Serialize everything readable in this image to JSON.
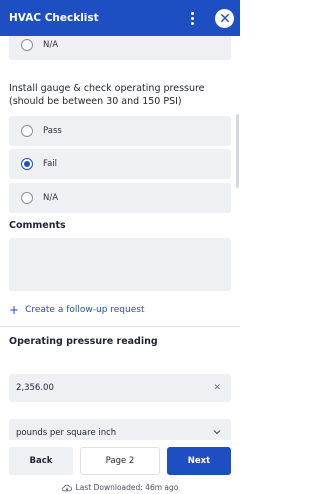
{
  "header": {
    "title": "HVAC Checklist"
  },
  "previous_question": {
    "options": [
      "N/A"
    ]
  },
  "question": {
    "text": "Install gauge & check operating pressure (should be between 30 and 150 PSI)",
    "options": [
      {
        "label": "Pass",
        "selected": false
      },
      {
        "label": "Fail",
        "selected": true
      },
      {
        "label": "N/A",
        "selected": false
      }
    ]
  },
  "comments": {
    "label": "Comments",
    "value": ""
  },
  "followup": {
    "label": "Create a follow-up request"
  },
  "reading": {
    "label": "Operating pressure reading",
    "value": "2,356.00",
    "unit": "pounds per square inch"
  },
  "footer": {
    "back_label": "Back",
    "page_label": "Page 2",
    "next_label": "Next",
    "last_downloaded": "Last Downloaded: 46m ago"
  },
  "colors": {
    "accent": "#1e4fc2",
    "field_bg": "#eff0f4"
  }
}
